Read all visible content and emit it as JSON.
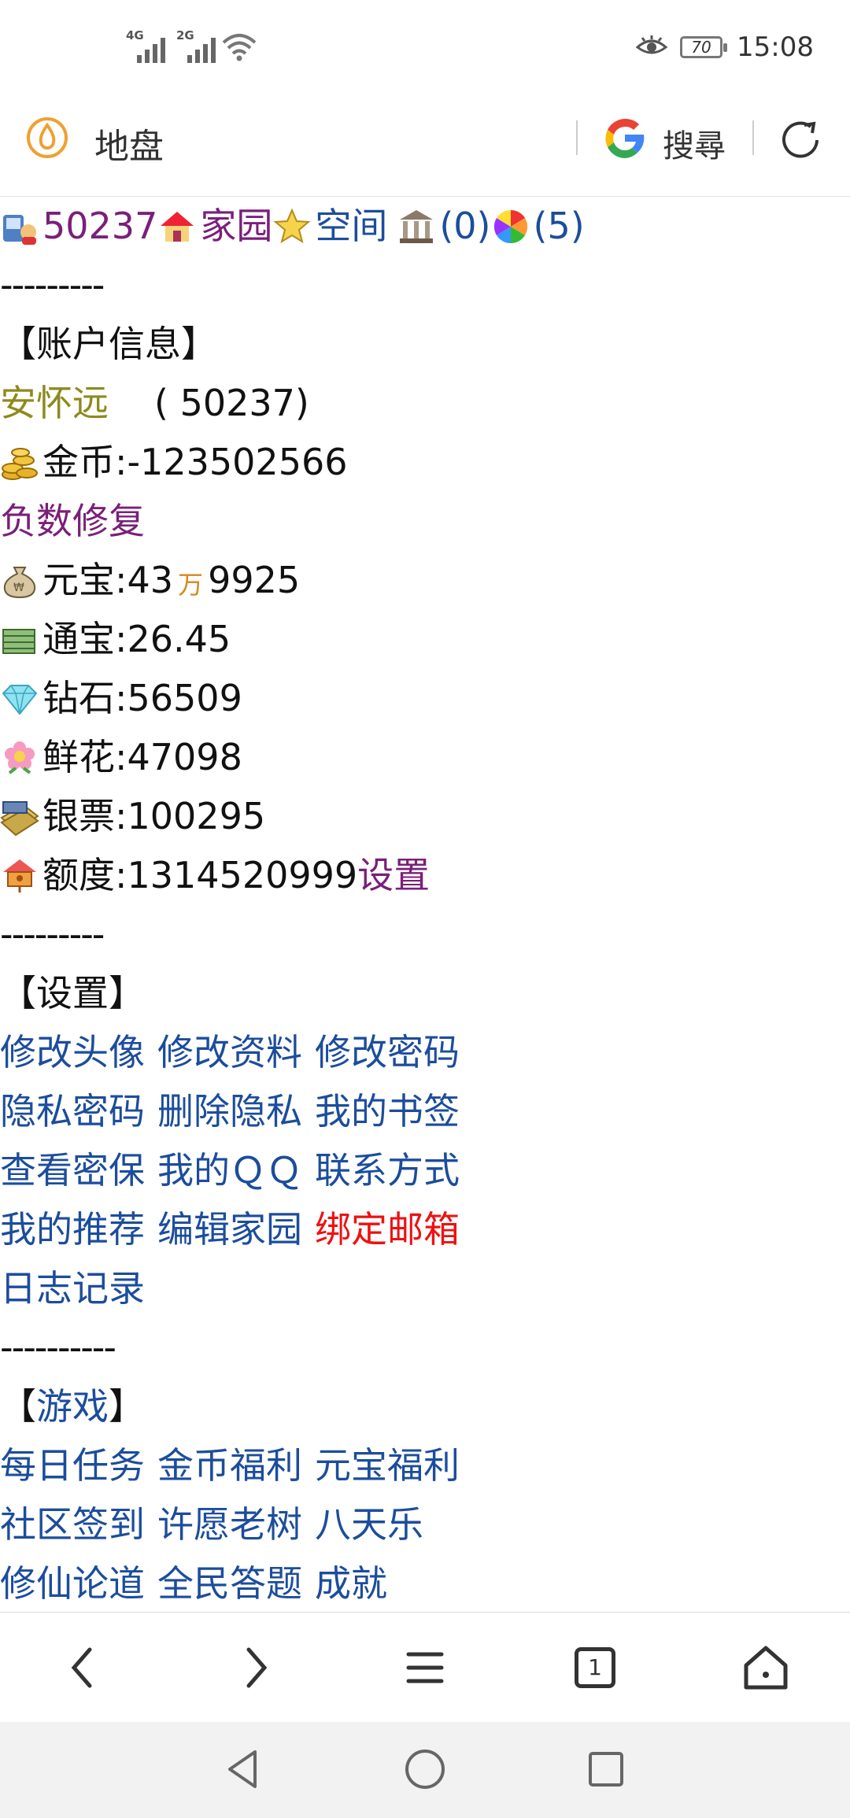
{
  "status_bar": {
    "signal1_label": "4G",
    "signal2_label": "2G",
    "battery": "70",
    "time": "15:08"
  },
  "address_bar": {
    "site_title": "地盘",
    "search_label": "搜尋"
  },
  "top_links": {
    "user_id": "50237",
    "home": "家园",
    "space": "空间",
    "bank_count": "(0)",
    "other_count": "(5)"
  },
  "divider1": "---------",
  "account": {
    "section_title": "【账户信息】",
    "username": "安怀远",
    "user_id_paren": "( 50237)",
    "gold_label": "金币:",
    "gold_value": "-123502566",
    "fix_negative": "负数修复",
    "yuanbao_label": "元宝:",
    "yuanbao_wan": "43",
    "wan_unit": "万",
    "yuanbao_rest": "9925",
    "tongbao": "通宝:26.45",
    "diamond": "钻石:56509",
    "flower": "鲜花:47098",
    "banknote": "银票:100295",
    "quota": "额度:1314520999",
    "quota_setting": "设置"
  },
  "divider2": "---------",
  "settings": {
    "section_title": "【设置】",
    "rows": [
      [
        "修改头像",
        "修改资料",
        "修改密码"
      ],
      [
        "隐私密码",
        "删除隐私",
        "我的书签"
      ],
      [
        "查看密保",
        "我的ＱＱ",
        "联系方式"
      ],
      [
        "我的推荐",
        "编辑家园",
        "绑定邮箱"
      ],
      [
        "日志记录"
      ]
    ]
  },
  "divider3": "----------",
  "games": {
    "section_title_open": "【",
    "section_title": "游戏",
    "section_title_close": "】",
    "rows": [
      [
        "每日任务",
        "金币福利",
        "元宝福利"
      ],
      [
        "社区签到",
        "许愿老树",
        "八天乐"
      ],
      [
        "修仙论道",
        "全民答题",
        "成就"
      ]
    ]
  },
  "bottom_nav": {
    "tab_count": "1"
  },
  "colors": {
    "link_blue": "#1c4d9c",
    "link_purple": "#7a1f7a",
    "highlight_red": "#ee1111",
    "username_olive": "#8d8a1d"
  }
}
